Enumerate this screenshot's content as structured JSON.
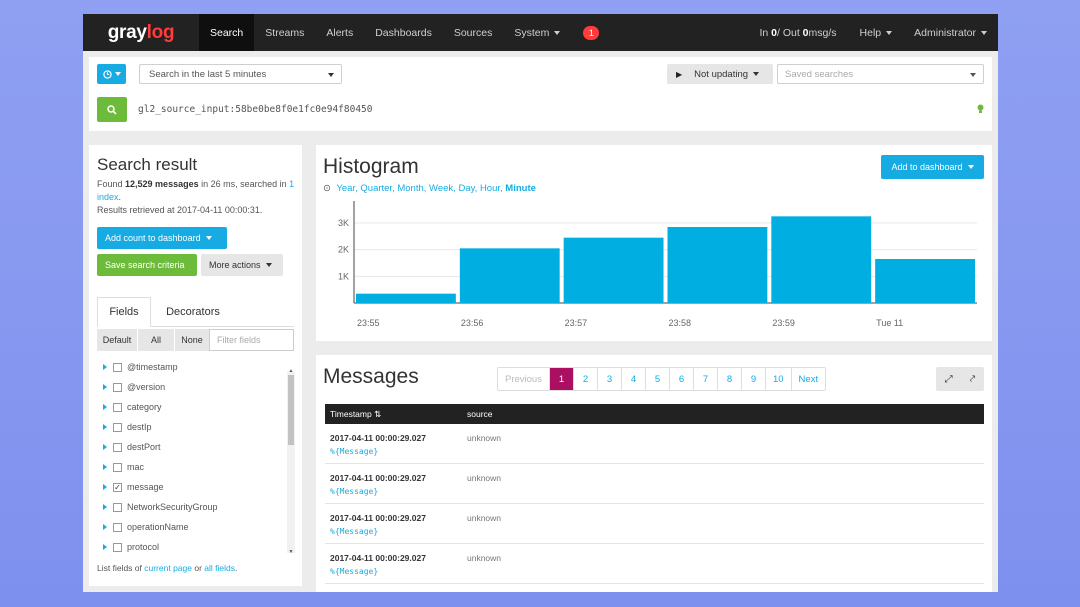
{
  "navbar": {
    "logo_part1": "gray",
    "logo_part2": "log",
    "items": [
      "Search",
      "Streams",
      "Alerts",
      "Dashboards",
      "Sources"
    ],
    "system_label": "System",
    "notification_count": "1",
    "throughput_in_label": "In ",
    "throughput_in": "0",
    "throughput_out_label": " / Out ",
    "throughput_out": "0",
    "throughput_unit": " msg/s",
    "help_label": "Help",
    "user_label": "Administrator"
  },
  "search": {
    "time_range": "Search in the last 5 minutes",
    "refresh_label": "Not updating",
    "saved_searches_placeholder": "Saved searches",
    "query": "gl2_source_input:58be0be8f0e1fc0e94f80450"
  },
  "sidebar": {
    "title": "Search result",
    "found_prefix": "Found ",
    "found_count": "12,529 messages",
    "found_mid": " in 26 ms, searched in ",
    "index_link": "1 index",
    "found_suffix": ".",
    "retrieved": "Results retrieved at 2017-04-11 00:00:31.",
    "add_count_label": "Add count to dashboard",
    "save_criteria_label": "Save search criteria",
    "more_actions_label": "More actions",
    "tabs": [
      "Fields",
      "Decorators"
    ],
    "filter_buttons": [
      "Default",
      "All",
      "None"
    ],
    "filter_placeholder": "Filter fields",
    "fields": [
      {
        "name": "@timestamp",
        "checked": false
      },
      {
        "name": "@version",
        "checked": false
      },
      {
        "name": "category",
        "checked": false
      },
      {
        "name": "destIp",
        "checked": false
      },
      {
        "name": "destPort",
        "checked": false
      },
      {
        "name": "mac",
        "checked": false
      },
      {
        "name": "message",
        "checked": true
      },
      {
        "name": "NetworkSecurityGroup",
        "checked": false
      },
      {
        "name": "operationName",
        "checked": false
      },
      {
        "name": "protocol",
        "checked": false
      }
    ],
    "footer_prefix": "List fields of ",
    "footer_link1": "current page",
    "footer_mid": " or ",
    "footer_link2": "all fields",
    "footer_suffix": "."
  },
  "histogram": {
    "title": "Histogram",
    "resolutions": [
      "Year",
      "Quarter",
      "Month",
      "Week",
      "Day",
      "Hour"
    ],
    "active_resolution": "Minute",
    "add_to_dashboard_label": "Add to dashboard"
  },
  "chart_data": {
    "type": "bar",
    "title": "Histogram",
    "categories": [
      "23:55",
      "23:56",
      "23:57",
      "23:58",
      "23:59",
      "Tue 11"
    ],
    "values": [
      350,
      2050,
      2450,
      2850,
      3250,
      1650
    ],
    "yticks": [
      "1K",
      "2K",
      "3K"
    ],
    "ytick_values": [
      1000,
      2000,
      3000
    ],
    "ylim": [
      0,
      3600
    ],
    "grid": true,
    "bar_color": "#00aee2"
  },
  "messages": {
    "title": "Messages",
    "pagination": {
      "previous": "Previous",
      "pages": [
        "1",
        "2",
        "3",
        "4",
        "5",
        "6",
        "7",
        "8",
        "9",
        "10"
      ],
      "active_page": "1",
      "next": "Next"
    },
    "columns": [
      "Timestamp",
      "source"
    ],
    "rows": [
      {
        "timestamp": "2017-04-11 00:00:29.027",
        "source": "unknown",
        "message": "%{Message}"
      },
      {
        "timestamp": "2017-04-11 00:00:29.027",
        "source": "unknown",
        "message": "%{Message}"
      },
      {
        "timestamp": "2017-04-11 00:00:29.027",
        "source": "unknown",
        "message": "%{Message}"
      },
      {
        "timestamp": "2017-04-11 00:00:29.027",
        "source": "unknown",
        "message": "%{Message}"
      }
    ]
  },
  "colors": {
    "accent": "#16ace3",
    "success": "#6dbb3b",
    "danger": "#ff3b3b",
    "active_page": "#ab0f61",
    "navbar": "#222222"
  }
}
